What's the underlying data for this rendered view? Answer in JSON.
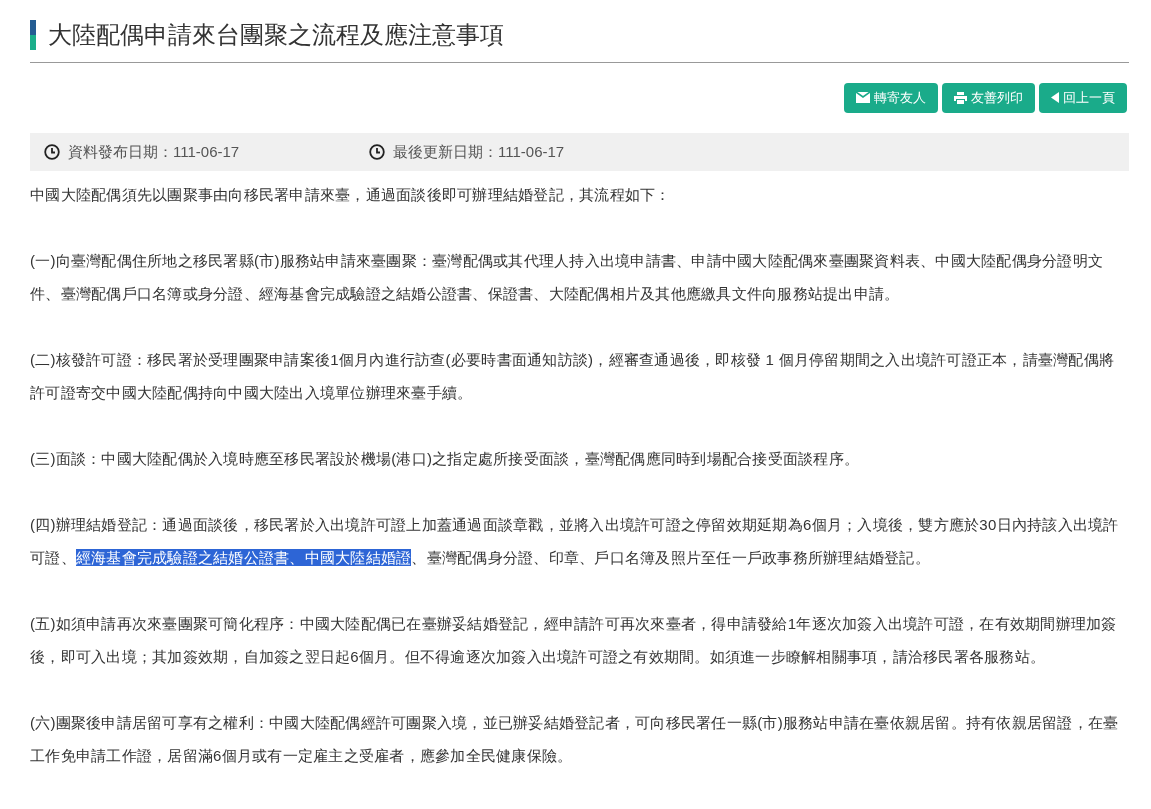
{
  "title": "大陸配偶申請來台團聚之流程及應注意事項",
  "buttons": [
    {
      "kind": "mail",
      "label": "轉寄友人"
    },
    {
      "kind": "print",
      "label": "友善列印"
    },
    {
      "kind": "back",
      "label": "回上一頁"
    }
  ],
  "dates": [
    {
      "label": "資料發布日期：111-06-17"
    },
    {
      "label": "最後更新日期：111-06-17"
    }
  ],
  "paragraphs": [
    {
      "segments": [
        {
          "text": "中國大陸配偶須先以團聚事由向移民署申請來臺，通過面談後即可辦理結婚登記，其流程如下：",
          "selected": false
        }
      ]
    },
    {
      "segments": [
        {
          "text": "(一)向臺灣配偶住所地之移民署縣(市)服務站申請來臺團聚：臺灣配偶或其代理人持入出境申請書、申請中國大陸配偶來臺團聚資料表、中國大陸配偶身分證明文件、臺灣配偶戶口名簿或身分證、經海基會完成驗證之結婚公證書、保證書、大陸配偶相片及其他應繳具文件向服務站提出申請。",
          "selected": false
        }
      ]
    },
    {
      "segments": [
        {
          "text": "(二)核發許可證：移民署於受理團聚申請案後1個月內進行訪查(必要時書面通知訪談)，經審查通過後，即核發 1 個月停留期間之入出境許可證正本，請臺灣配偶將許可證寄交中國大陸配偶持向中國大陸出入境單位辦理來臺手續。",
          "selected": false
        }
      ]
    },
    {
      "segments": [
        {
          "text": "(三)面談：中國大陸配偶於入境時應至移民署設於機場(港口)之指定處所接受面談，臺灣配偶應同時到場配合接受面談程序。",
          "selected": false
        }
      ]
    },
    {
      "segments": [
        {
          "text": "(四)辦理結婚登記：通過面談後，移民署於入出境許可證上加蓋通過面談章戳，並將入出境許可證之停留效期延期為6個月；入境後，雙方應於30日內持該入出境許可證、",
          "selected": false
        },
        {
          "text": "經海基會完成驗證之結婚公證書、中國大陸結婚證",
          "selected": true
        },
        {
          "text": "、臺灣配偶身分證、印章、戶口名簿及照片至任一戶政事務所辦理結婚登記。",
          "selected": false
        }
      ]
    },
    {
      "segments": [
        {
          "text": "(五)如須申請再次來臺團聚可簡化程序：中國大陸配偶已在臺辦妥結婚登記，經申請許可再次來臺者，得申請發給1年逐次加簽入出境許可證，在有效期間辦理加簽後，即可入出境；其加簽效期，自加簽之翌日起6個月。但不得逾逐次加簽入出境許可證之有效期間。如須進一步瞭解相關事項，請洽移民署各服務站。",
          "selected": false
        }
      ]
    },
    {
      "segments": [
        {
          "text": "(六)團聚後申請居留可享有之權利：中國大陸配偶經許可團聚入境，並已辦妥結婚登記者，可向移民署任一縣(市)服務站申請在臺依親居留。持有依親居留證，在臺工作免申請工作證，居留滿6個月或有一定雇主之受雇者，應參加全民健康保險。",
          "selected": false
        }
      ]
    }
  ]
}
